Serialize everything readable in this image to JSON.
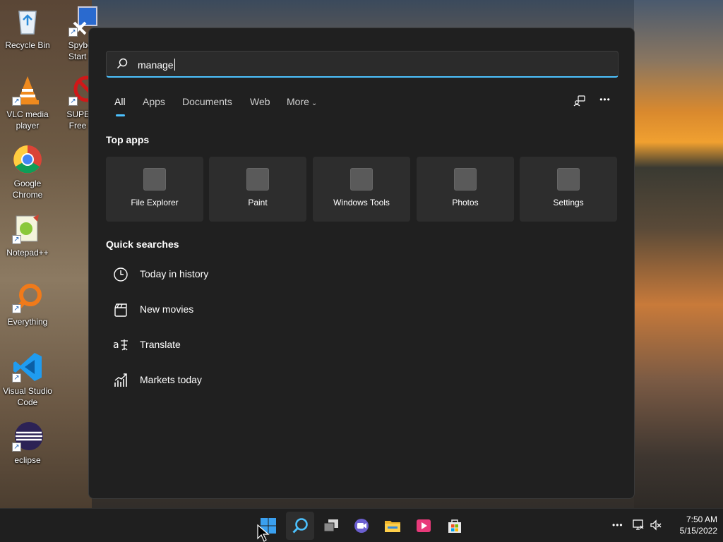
{
  "desktop": {
    "icons": [
      {
        "label_1": "Recycle Bin",
        "label_2": ""
      },
      {
        "label_1": "Spybot -",
        "label_2": "Start Ce"
      },
      {
        "label_1": "VLC media",
        "label_2": "player"
      },
      {
        "label_1": "SUPERA",
        "label_2": "Free Ed"
      },
      {
        "label_1": "Google",
        "label_2": "Chrome"
      },
      {
        "label_1": "Notepad++",
        "label_2": ""
      },
      {
        "label_1": "Everything",
        "label_2": ""
      },
      {
        "label_1": "Visual Studio",
        "label_2": "Code"
      },
      {
        "label_1": "eclipse",
        "label_2": ""
      }
    ]
  },
  "search": {
    "query": "manage",
    "icon": "search-icon"
  },
  "tabs": [
    {
      "label": "All",
      "active": true
    },
    {
      "label": "Apps",
      "active": false
    },
    {
      "label": "Documents",
      "active": false
    },
    {
      "label": "Web",
      "active": false
    },
    {
      "label": "More",
      "active": false
    }
  ],
  "header_actions": {
    "icons": [
      "share-icon",
      "more-options-icon"
    ],
    "more_label": "•••"
  },
  "top_apps": {
    "title": "Top apps",
    "items": [
      "File Explorer",
      "Paint",
      "Windows Tools",
      "Photos",
      "Settings"
    ]
  },
  "quick_searches": {
    "title": "Quick searches",
    "items": [
      {
        "label": "Today in history",
        "icon": "clock-icon"
      },
      {
        "label": "New movies",
        "icon": "clapperboard-icon"
      },
      {
        "label": "Translate",
        "icon": "translate-icon"
      },
      {
        "label": "Markets today",
        "icon": "chart-icon"
      }
    ]
  },
  "taskbar": {
    "icons": [
      "windows-start-icon",
      "search-icon",
      "task-view-icon",
      "teams-chat-icon",
      "file-explorer-icon",
      "media-app-icon",
      "microsoft-store-icon"
    ],
    "tray_more": "•••",
    "time": "7:50 AM",
    "date": "5/15/2022"
  },
  "colors": {
    "accent": "#4cc2ff",
    "panel_bg": "#202020",
    "tile_bg": "#2d2d2d"
  }
}
